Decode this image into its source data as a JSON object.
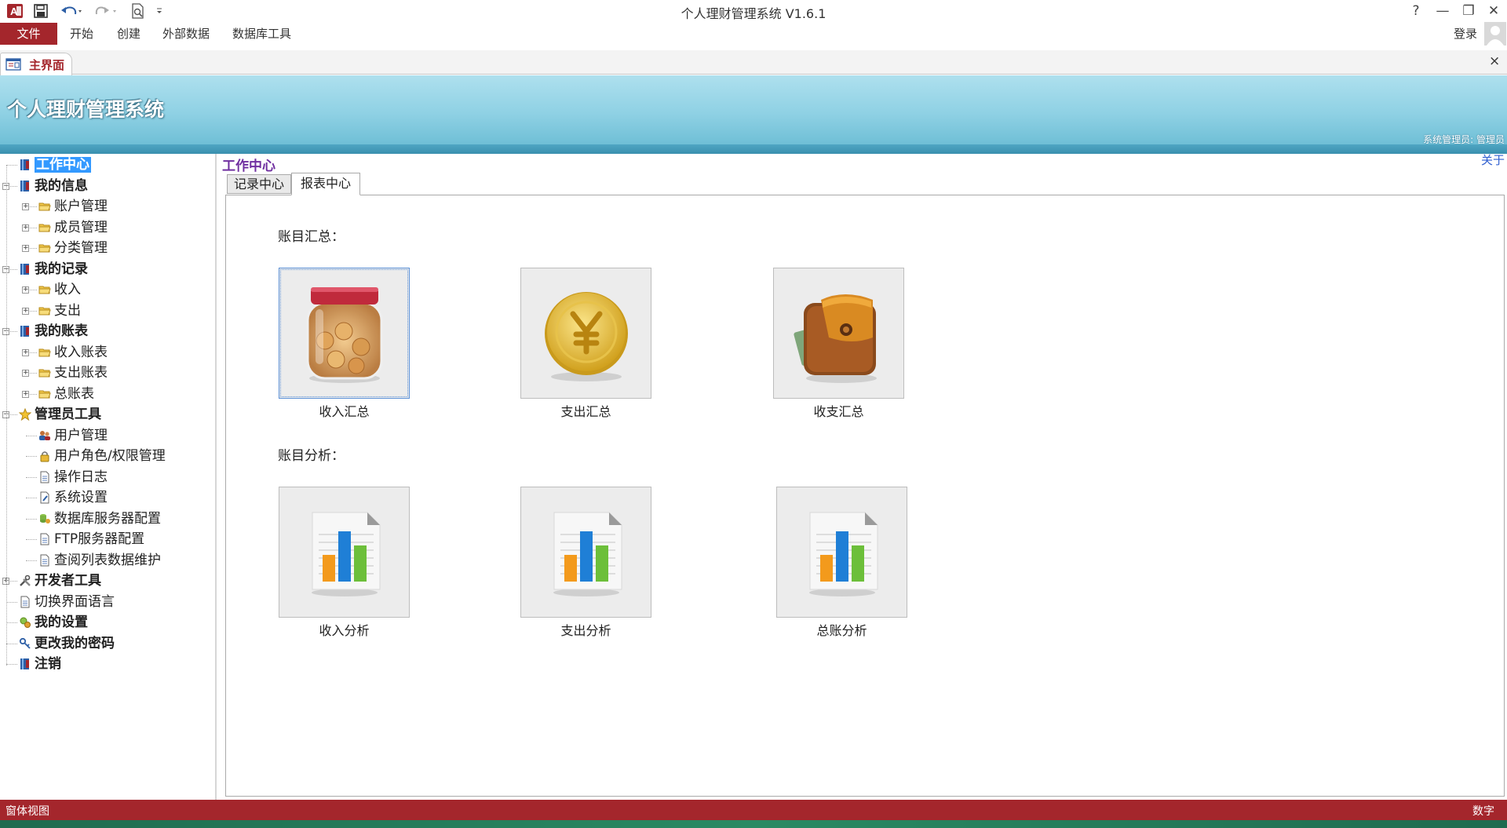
{
  "window": {
    "title": "个人理财管理系统 V1.6.1",
    "help": "?",
    "minimize": "—",
    "restore": "❐",
    "close": "✕"
  },
  "ribbon": {
    "file": "文件",
    "tabs": [
      "开始",
      "创建",
      "外部数据",
      "数据库工具"
    ],
    "login": "登录"
  },
  "doc_tab": {
    "label": "主界面",
    "close": "×"
  },
  "header": {
    "app_title": "个人理财管理系统",
    "user_info": "系统管理员: 管理员"
  },
  "tree": {
    "nodes": [
      {
        "label": "工作中心",
        "icon": "book-icon",
        "level": 0,
        "selected": true
      },
      {
        "label": "我的信息",
        "icon": "book-icon",
        "level": 0,
        "expanded": true
      },
      {
        "label": "账户管理",
        "icon": "folder-icon",
        "level": 1
      },
      {
        "label": "成员管理",
        "icon": "folder-icon",
        "level": 1
      },
      {
        "label": "分类管理",
        "icon": "folder-icon",
        "level": 1
      },
      {
        "label": "我的记录",
        "icon": "book-icon",
        "level": 0,
        "expanded": true
      },
      {
        "label": "收入",
        "icon": "folder-icon",
        "level": 1
      },
      {
        "label": "支出",
        "icon": "folder-icon",
        "level": 1
      },
      {
        "label": "我的账表",
        "icon": "book-icon",
        "level": 0,
        "expanded": true
      },
      {
        "label": "收入账表",
        "icon": "folder-icon",
        "level": 1
      },
      {
        "label": "支出账表",
        "icon": "folder-icon",
        "level": 1
      },
      {
        "label": "总账表",
        "icon": "folder-icon",
        "level": 1
      },
      {
        "label": "管理员工具",
        "icon": "star-icon",
        "level": 0,
        "expanded": true
      },
      {
        "label": "用户管理",
        "icon": "users-icon",
        "level": 1
      },
      {
        "label": "用户角色/权限管理",
        "icon": "lock-icon",
        "level": 1
      },
      {
        "label": "操作日志",
        "icon": "document-icon",
        "level": 1
      },
      {
        "label": "系统设置",
        "icon": "settings-doc-icon",
        "level": 1
      },
      {
        "label": "数据库服务器配置",
        "icon": "database-icon",
        "level": 1
      },
      {
        "label": "FTP服务器配置",
        "icon": "document-icon",
        "level": 1
      },
      {
        "label": "查阅列表数据维护",
        "icon": "document-icon",
        "level": 1
      },
      {
        "label": "开发者工具",
        "icon": "tools-icon",
        "level": 0,
        "expanded": false
      },
      {
        "label": "切换界面语言",
        "icon": "document-icon",
        "level": 0,
        "plain": true
      },
      {
        "label": "我的设置",
        "icon": "settings-icon",
        "level": 0
      },
      {
        "label": "更改我的密码",
        "icon": "key-icon",
        "level": 0
      },
      {
        "label": "注销",
        "icon": "book-icon",
        "level": 0
      }
    ]
  },
  "main": {
    "title": "工作中心",
    "about": "关于",
    "tabs": {
      "record": "记录中心",
      "report": "报表中心"
    },
    "summary_label": "账目汇总：",
    "analysis_label": "账目分析：",
    "summary_tiles": [
      {
        "label": "收入汇总",
        "icon": "coin-jar-icon"
      },
      {
        "label": "支出汇总",
        "icon": "yen-coin-icon"
      },
      {
        "label": "收支汇总",
        "icon": "wallet-icon"
      }
    ],
    "analysis_tiles": [
      {
        "label": "收入分析",
        "icon": "bar-chart-document-icon"
      },
      {
        "label": "支出分析",
        "icon": "bar-chart-document-icon"
      },
      {
        "label": "总账分析",
        "icon": "bar-chart-document-icon"
      }
    ]
  },
  "status": {
    "left": "窗体视图",
    "right": "数字"
  },
  "colors": {
    "accent": "#a4262c",
    "banner": "#8fd1e4",
    "selection": "#3399ff"
  }
}
